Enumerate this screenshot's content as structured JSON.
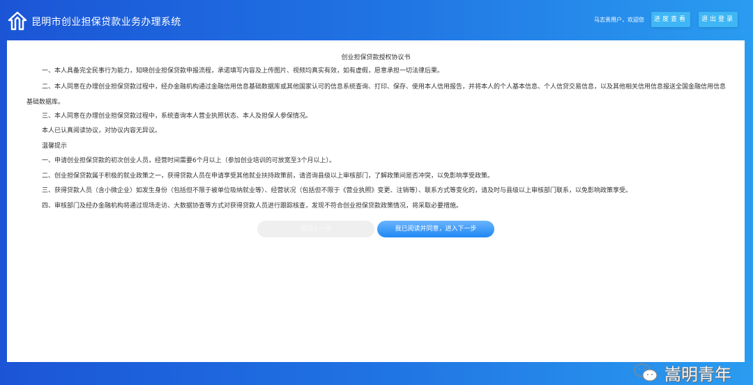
{
  "header": {
    "title": "昆明市创业担保贷款业务办理系统",
    "welcome": "马志贵用户，欢迎您",
    "progress_button": "进度查看",
    "logout_button": "退出登录"
  },
  "doc": {
    "title": "创业担保贷款授权协议书",
    "paragraphs": [
      "一、本人具备完全民事行为能力，知晓创业担保贷款申报流程，承诺填写内容及上传图片、视频均真实有效，如有虚假，愿意承担一切法律后果。",
      "二、本人同意在办理创业担保贷款过程中，经办金融机构通过金融信用信息基础数据库或其他国家认可的信息系统查询、打印、保存、使用本人信用报告，并将本人的个人基本信息、个人信贷交易信息，以及其他相关信用信息报送全国金融信用信息基础数据库。",
      "三、本人同意在办理创业担保贷款过程中，系统查询本人营业执照状态、本人及担保人参保情况。",
      "本人已认真阅读协议，对协议内容无异议。"
    ],
    "tips_heading": "温馨提示",
    "tips": [
      "一、申请创业担保贷款的初次创业人员，经营时间需要6个月以上（参加创业培训的可放宽至3个月以上）。",
      "二、创业担保贷款属于积极的就业政策之一，获得贷款人员在申请享受其他就业扶持政策前，请咨询县级以上审核部门，了解政策间是否冲突，以免影响享受政策。",
      "三、获得贷款人员（含小微企业）如发生身份（包括但不限于被单位吸纳就业等）、经营状况（包括但不限于《营业执照》变更、注销等）、联系方式等变化的，请及时与县级以上审核部门联系，以免影响政策享受。",
      "四、审核部门及经办金融机构将通过现场走访、大数据协查等方式对获得贷款人员进行跟踪核查，发现不符合创业担保贷款政策情况，将采取必要措施。"
    ]
  },
  "actions": {
    "back": "返回上一步",
    "agree": "我已阅读并同意，进入下一步"
  },
  "watermark": "嵩明青年"
}
